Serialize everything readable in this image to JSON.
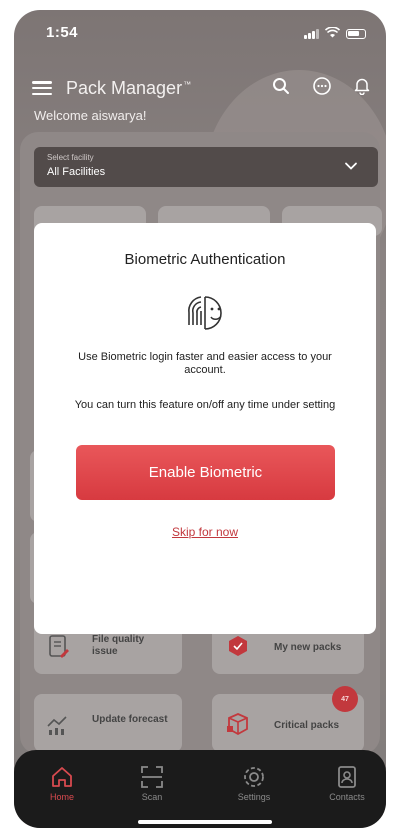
{
  "status": {
    "time": "1:54"
  },
  "header": {
    "title": "Pack Manager",
    "trademark": "™"
  },
  "welcome": "Welcome aiswarya!",
  "facility": {
    "label": "Select facility",
    "value": "All Facilities"
  },
  "tiles": [
    {
      "label": "File quality issue",
      "icon": "file-icon"
    },
    {
      "label": "My new packs",
      "icon": "cube-icon"
    },
    {
      "label": "Update forecast",
      "icon": "chart-icon"
    },
    {
      "label": "Critical packs",
      "icon": "box-icon",
      "badge": "47"
    }
  ],
  "nav": [
    {
      "label": "Home",
      "icon": "home-icon",
      "active": true
    },
    {
      "label": "Scan",
      "icon": "scan-icon"
    },
    {
      "label": "Settings",
      "icon": "gear-icon"
    },
    {
      "label": "Contacts",
      "icon": "contact-icon"
    }
  ],
  "modal": {
    "title": "Biometric Authentication",
    "icon": "biometric-icon",
    "line1": "Use Biometric login faster and easier access to your account.",
    "line2": "You can turn this feature on/off any time under setting",
    "enable_label": "Enable Biometric",
    "skip_label": "Skip for now"
  },
  "colors": {
    "accent": "#d73a40",
    "overlay": "#7d7574",
    "navbar": "#1b1b1b"
  }
}
